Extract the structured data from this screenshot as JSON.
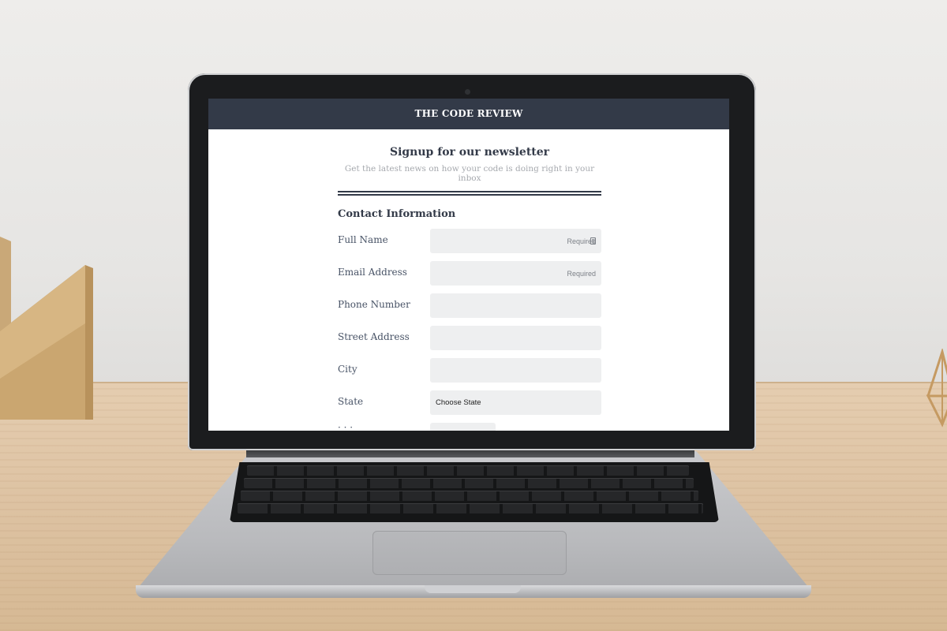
{
  "site": {
    "title": "THE CODE REVIEW"
  },
  "newsletter": {
    "heading": "Signup for our newsletter",
    "subheading": "Get the latest news on how your code is doing right in your inbox"
  },
  "form": {
    "section_title": "Contact Information",
    "fields": {
      "full_name": {
        "label": "Full Name",
        "placeholder": "Required"
      },
      "email": {
        "label": "Email Address",
        "placeholder": "Required"
      },
      "phone": {
        "label": "Phone Number",
        "placeholder": ""
      },
      "street": {
        "label": "Street Address",
        "placeholder": ""
      },
      "city": {
        "label": "City",
        "placeholder": ""
      },
      "state": {
        "label": "State",
        "selected": "Choose State"
      }
    }
  },
  "icons": {
    "autofill": "contact-card-icon"
  }
}
